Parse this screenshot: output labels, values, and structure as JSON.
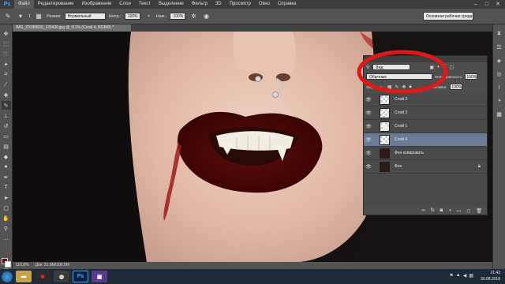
{
  "app": {
    "logo": "Ps",
    "menu": [
      "Файл",
      "Редактирование",
      "Изображение",
      "Слои",
      "Текст",
      "Выделение",
      "Фильтр",
      "3D",
      "Просмотр",
      "Окно",
      "Справка"
    ]
  },
  "options": {
    "brush_size": "1",
    "mode_label": "Режим:",
    "mode_value": "Нормальный",
    "opacity_label": "Непр.:",
    "opacity_value": "100%",
    "flow_label": "Наж.:",
    "flow_value": "100%",
    "workspace": "Основная рабочая среда"
  },
  "document": {
    "tab_title": "IMG_20180830_135430.jpg @ 111% (Слой 4, RGB/8) *"
  },
  "status": {
    "zoom": "110,8%",
    "doc_size": "Док: 31,9M/100,5M"
  },
  "layers_panel": {
    "filter_value": "Вид",
    "blend_mode": "Обычные",
    "opacity_label": "Непрозрачность:",
    "opacity_value": "100%",
    "lock_label": "Закрепить:",
    "fill_label": "Заливка:",
    "fill_value": "100%",
    "layers": [
      {
        "name": "Слой 3",
        "thumb": "transparent",
        "selected": false,
        "locked": false
      },
      {
        "name": "Слой 2",
        "thumb": "transparent",
        "selected": false,
        "locked": false
      },
      {
        "name": "Слой 1",
        "thumb": "blob",
        "selected": false,
        "locked": false
      },
      {
        "name": "Слой 4",
        "thumb": "transparent",
        "selected": true,
        "locked": false
      },
      {
        "name": "Фон копировать",
        "thumb": "photo",
        "selected": false,
        "locked": false
      },
      {
        "name": "Фон",
        "thumb": "photo",
        "selected": false,
        "locked": true
      }
    ]
  },
  "taskbar": {
    "time": "21:43",
    "date": "30.08.2018",
    "apps": [
      "explorer",
      "media",
      "chrome",
      "photoshop",
      "app"
    ]
  },
  "colors": {
    "foreground": "#5a0f0f",
    "background": "#ffffff",
    "annotation": "#e01818",
    "selected_layer": "#6a7c94"
  }
}
